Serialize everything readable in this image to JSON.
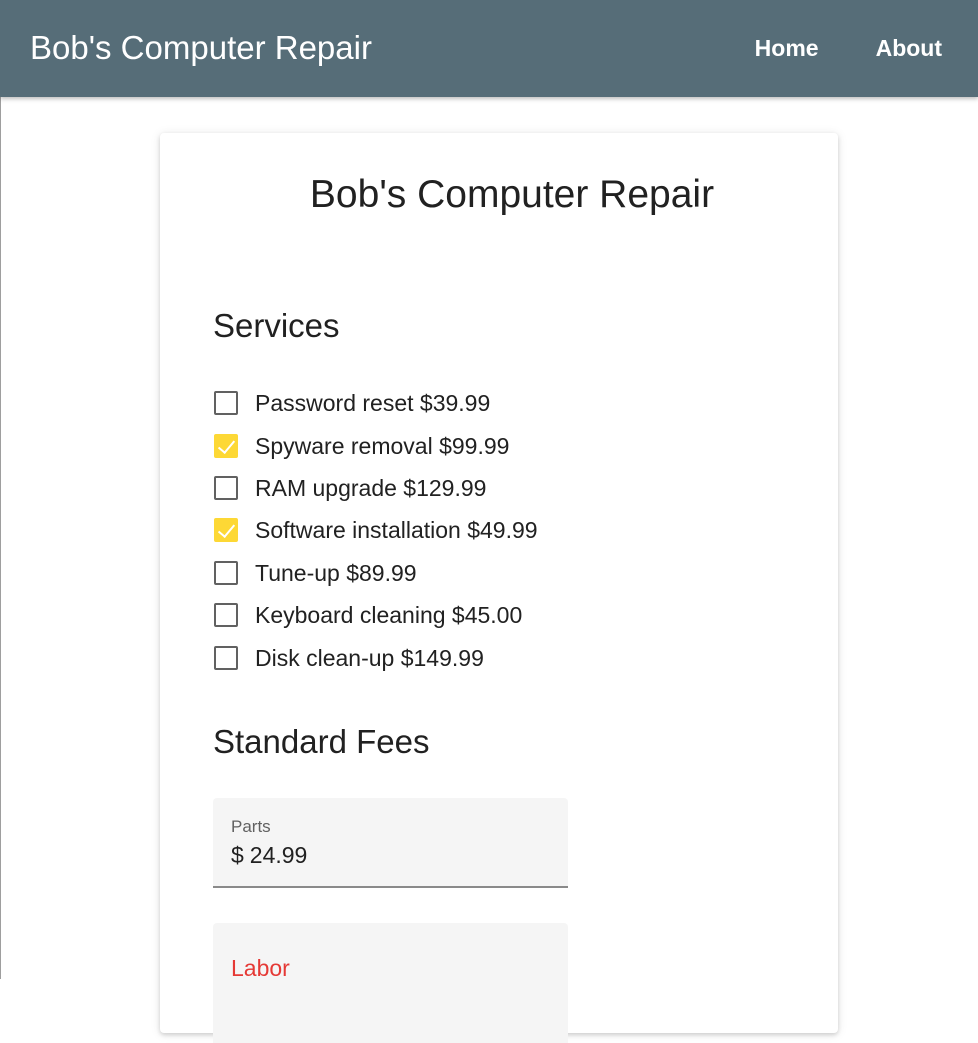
{
  "header": {
    "brand": "Bob's Computer Repair",
    "nav": [
      {
        "label": "Home"
      },
      {
        "label": "About"
      }
    ],
    "background_color": "#566d78"
  },
  "card": {
    "title": "Bob's Computer Repair",
    "services_heading": "Services",
    "services": [
      {
        "label": "Password reset $39.99",
        "checked": false
      },
      {
        "label": "Spyware removal $99.99",
        "checked": true
      },
      {
        "label": "RAM upgrade $129.99",
        "checked": false
      },
      {
        "label": "Software installation $49.99",
        "checked": true
      },
      {
        "label": "Tune-up $89.99",
        "checked": false
      },
      {
        "label": "Keyboard cleaning $45.00",
        "checked": false
      },
      {
        "label": "Disk clean-up $149.99",
        "checked": false
      }
    ],
    "fees_heading": "Standard Fees",
    "fees": {
      "parts": {
        "label": "Parts",
        "prefix": "$",
        "value": "24.99"
      },
      "labor": {
        "label": "Labor",
        "label_color": "#e53935"
      }
    },
    "accent_color": "#fdd835"
  }
}
